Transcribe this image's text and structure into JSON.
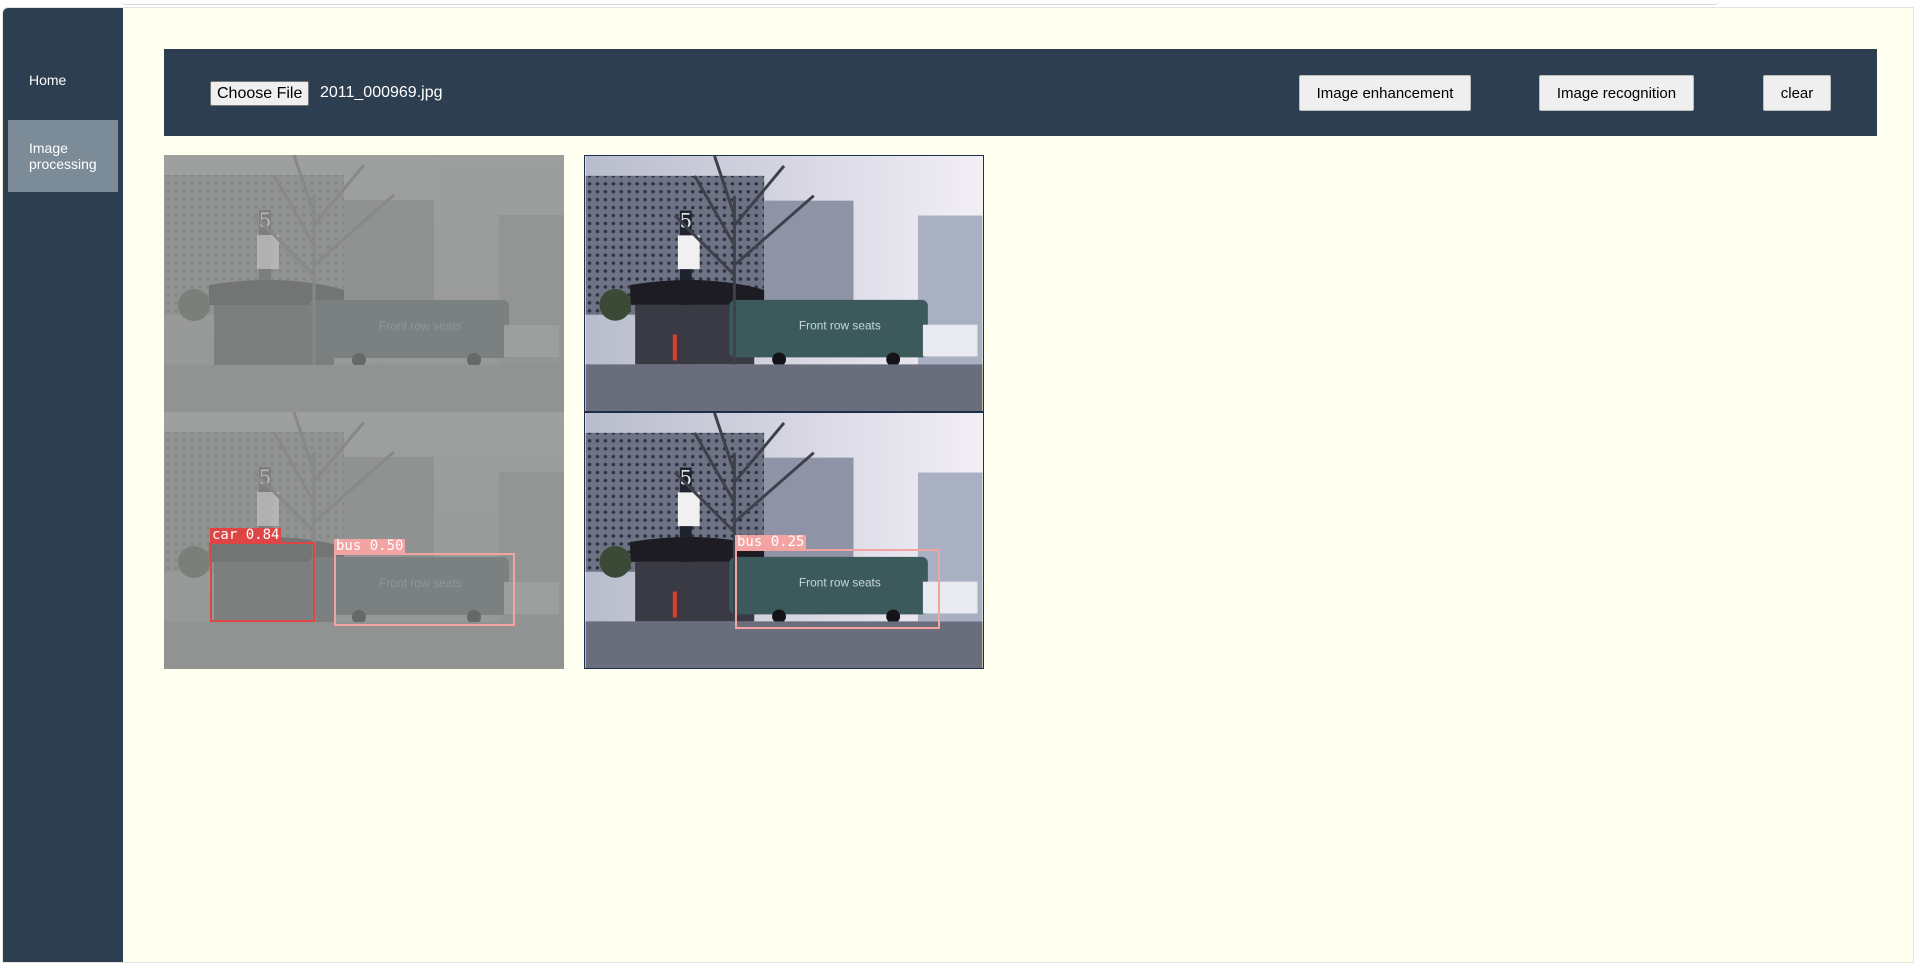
{
  "sidebar": {
    "items": [
      {
        "label": "Home"
      },
      {
        "label": "Image processing",
        "active": true
      }
    ]
  },
  "toolbar": {
    "choose_file_label": "Choose File",
    "file_name": "2011_000969.jpg",
    "enhance_label": "Image enhancement",
    "recognize_label": "Image recognition",
    "clear_label": "clear"
  },
  "detections": {
    "original": [
      {
        "label": "car 0.84",
        "color": "#e04545"
      },
      {
        "label": "bus 0.50",
        "color": "#f4a3a3"
      }
    ],
    "enhanced": [
      {
        "label": "bus 0.25",
        "color": "#f4a3a3"
      }
    ]
  },
  "colors": {
    "sidebar_bg": "#2c3e50",
    "sidebar_active": "#7b8b98",
    "toolbar_bg": "#2c3e50",
    "page_bg": "#fffff0"
  },
  "photo_text": {
    "bus_side": "Front row seats",
    "sign_number": "5"
  }
}
